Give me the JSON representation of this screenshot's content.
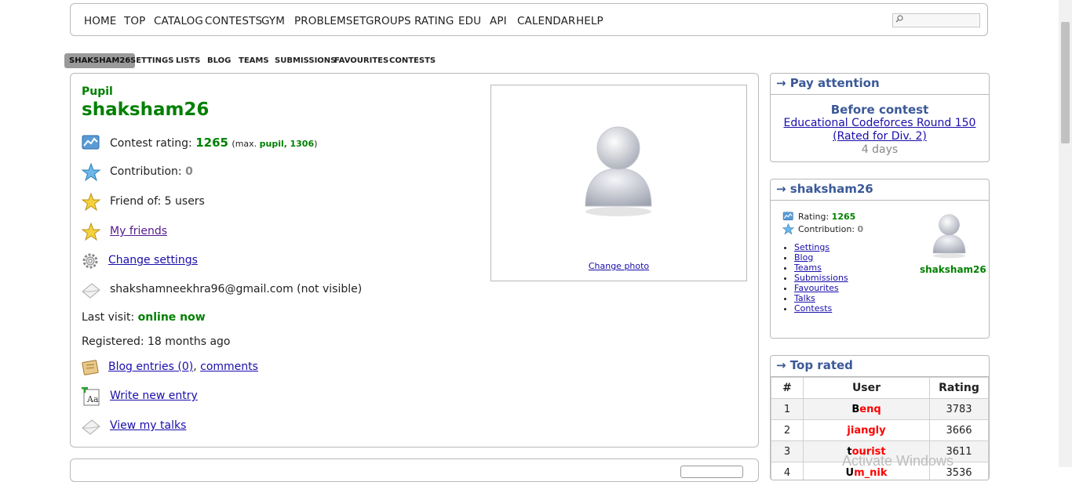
{
  "nav": {
    "items": [
      "HOME",
      "TOP",
      "CATALOG",
      "CONTESTS",
      "GYM",
      "PROBLEMSET",
      "GROUPS",
      "RATING",
      "EDU",
      "API",
      "CALENDAR",
      "HELP"
    ],
    "search_placeholder": ""
  },
  "subnav": {
    "tabs": [
      "SHAKSHAM26",
      "SETTINGS",
      "LISTS",
      "BLOG",
      "TEAMS",
      "SUBMISSIONS",
      "FAVOURITES",
      "CONTESTS"
    ],
    "active": "SHAKSHAM26"
  },
  "profile": {
    "rank": "Pupil",
    "handle": "shaksham26",
    "contest_rating_label": "Contest rating:",
    "rating": "1265",
    "max_open": "(max.",
    "max_rank": "pupil,",
    "max_rating": "1306",
    "max_close": ")",
    "contribution_label": "Contribution:",
    "contribution": "0",
    "friend_of": "Friend of: 5 users",
    "my_friends": "My friends",
    "change_settings": "Change settings",
    "email": "shakshamneekhra96@gmail.com (not visible)",
    "last_visit_label": "Last visit:",
    "last_visit": "online now",
    "registered": "Registered: 18 months ago",
    "blog_entries": "Blog entries (0)",
    "comma": ",",
    "comments": "comments",
    "write_entry": "Write new entry",
    "view_talks": "View my talks",
    "change_photo": "Change photo"
  },
  "pay_attention": {
    "caption": "→ Pay attention",
    "title": "Before contest",
    "contest_line1": "Educational Codeforces Round 150",
    "contest_line2": "(Rated for Div. 2)",
    "time": "4 days"
  },
  "mini": {
    "caption": "→ shaksham26",
    "rating_label": "Rating:",
    "rating": "1265",
    "contribution_label": "Contribution:",
    "contribution": "0",
    "links": [
      "Settings",
      "Blog",
      "Teams",
      "Submissions",
      "Favourites",
      "Talks",
      "Contests"
    ],
    "name": "shaksham26"
  },
  "top_rated": {
    "caption": "→ Top rated",
    "headers": [
      "#",
      "User",
      "Rating"
    ],
    "rows": [
      {
        "rank": "1",
        "first": "B",
        "rest": "enq",
        "rating": "3783"
      },
      {
        "rank": "2",
        "first": "j",
        "rest": "iangly",
        "rating": "3666"
      },
      {
        "rank": "3",
        "first": "t",
        "rest": "ourist",
        "rating": "3611"
      },
      {
        "rank": "4",
        "first": "U",
        "rest": "m_nik",
        "rating": "3536"
      }
    ]
  },
  "watermark": "Activate Windows",
  "colors": {
    "pupil": "#008000",
    "caption": "#3b5998",
    "legendary": "#ff0000",
    "link": "#1a0dab"
  }
}
